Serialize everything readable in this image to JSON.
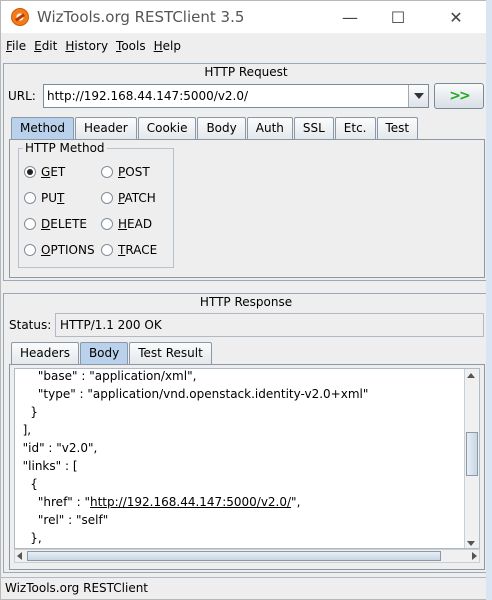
{
  "window": {
    "title": "WizTools.org RESTClient 3.5",
    "controls": {
      "minimize": "—",
      "maximize": "☐",
      "close": "✕"
    }
  },
  "menu": {
    "items": [
      {
        "label": "File",
        "mnemonic": "F",
        "rest": "ile"
      },
      {
        "label": "Edit",
        "mnemonic": "E",
        "rest": "dit"
      },
      {
        "label": "History",
        "mnemonic": "H",
        "rest": "istory"
      },
      {
        "label": "Tools",
        "mnemonic": "T",
        "rest": "ools"
      },
      {
        "label": "Help",
        "mnemonic": "H",
        "rest": "elp"
      }
    ]
  },
  "request": {
    "panel_title": "HTTP Request",
    "url_label": "URL:",
    "url_value": "http://192.168.44.147:5000/v2.0/",
    "go_label": ">>",
    "tabs": [
      "Method",
      "Header",
      "Cookie",
      "Body",
      "Auth",
      "SSL",
      "Etc.",
      "Test"
    ],
    "active_tab": "Method",
    "method_group_title": "HTTP Method",
    "methods": [
      {
        "pre": "",
        "ul": "G",
        "post": "ET",
        "checked": true
      },
      {
        "pre": "",
        "ul": "P",
        "post": "OST",
        "checked": false
      },
      {
        "pre": "PU",
        "ul": "T",
        "post": "",
        "checked": false
      },
      {
        "pre": "",
        "ul": "P",
        "post": "ATCH",
        "checked": false
      },
      {
        "pre": "",
        "ul": "D",
        "post": "ELETE",
        "checked": false
      },
      {
        "pre": "",
        "ul": "H",
        "post": "EAD",
        "checked": false
      },
      {
        "pre": "",
        "ul": "O",
        "post": "PTIONS",
        "checked": false
      },
      {
        "pre": "",
        "ul": "T",
        "post": "RACE",
        "checked": false
      }
    ]
  },
  "response": {
    "panel_title": "HTTP Response",
    "status_label": "Status:",
    "status_value": "HTTP/1.1 200 OK",
    "tabs": [
      "Headers",
      "Body",
      "Test Result"
    ],
    "active_tab": "Body",
    "body_lines": [
      "      \"base\" : \"application/xml\",",
      "      \"type\" : \"application/vnd.openstack.identity-v2.0+xml\"",
      "    }",
      "  ],",
      "  \"id\" : \"v2.0\",",
      "  \"links\" : [",
      "    {",
      "      \"href\" : \"",
      "      \"rel\" : \"self\"",
      "    },"
    ],
    "href_link": "http://192.168.44.147:5000/v2.0/",
    "href_tail": "\","
  },
  "statusbar": {
    "text": "WizTools.org RESTClient"
  }
}
